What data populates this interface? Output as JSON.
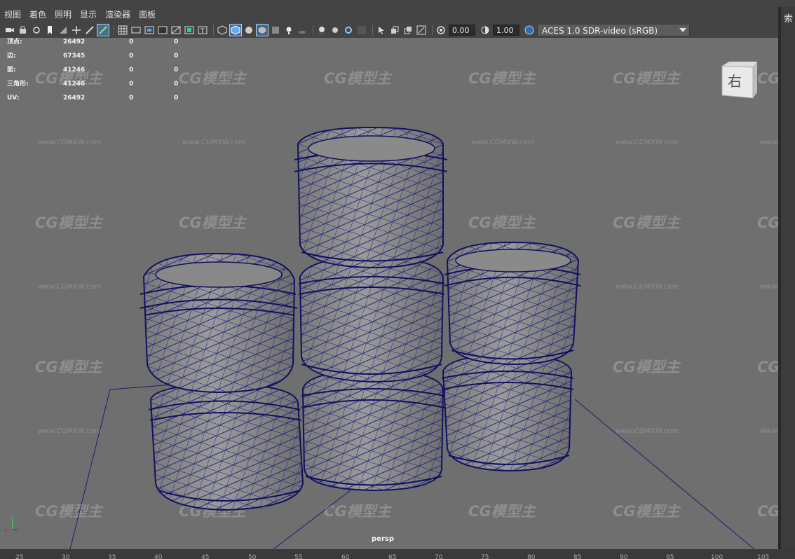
{
  "menu": {
    "items": [
      "视图",
      "着色",
      "照明",
      "显示",
      "渲染器",
      "面板"
    ]
  },
  "toolbar": {
    "exposure_value": "0.00",
    "gamma_value": "1.00",
    "color_space": "ACES 1.0 SDR-video (sRGB)"
  },
  "hud": {
    "rows": [
      {
        "label": "顶点:",
        "v1": "26492",
        "v2": "0",
        "v3": "0"
      },
      {
        "label": "边:",
        "v1": "67345",
        "v2": "0",
        "v3": "0"
      },
      {
        "label": "面:",
        "v1": "41246",
        "v2": "0",
        "v3": "0"
      },
      {
        "label": "三角形:",
        "v1": "41246",
        "v2": "0",
        "v3": "0"
      },
      {
        "label": "UV:",
        "v1": "26492",
        "v2": "0",
        "v3": "0"
      }
    ]
  },
  "viewcube": {
    "face_label": "右"
  },
  "viewport": {
    "camera_name": "persp"
  },
  "right_panel": {
    "label": "索"
  },
  "watermark": {
    "logo": "CG模型主",
    "url": "www.CGMXW.com"
  },
  "ruler": {
    "ticks": [
      "25",
      "30",
      "35",
      "40",
      "45",
      "50",
      "55",
      "60",
      "65",
      "70",
      "75",
      "80",
      "85",
      "90",
      "95",
      "100",
      "105"
    ]
  },
  "colors": {
    "viewport_bg": "#6f6f6f",
    "wireframe": "#1a1a7a",
    "mesh_fill": "#8a8a8a",
    "ui_bg": "#444444"
  }
}
